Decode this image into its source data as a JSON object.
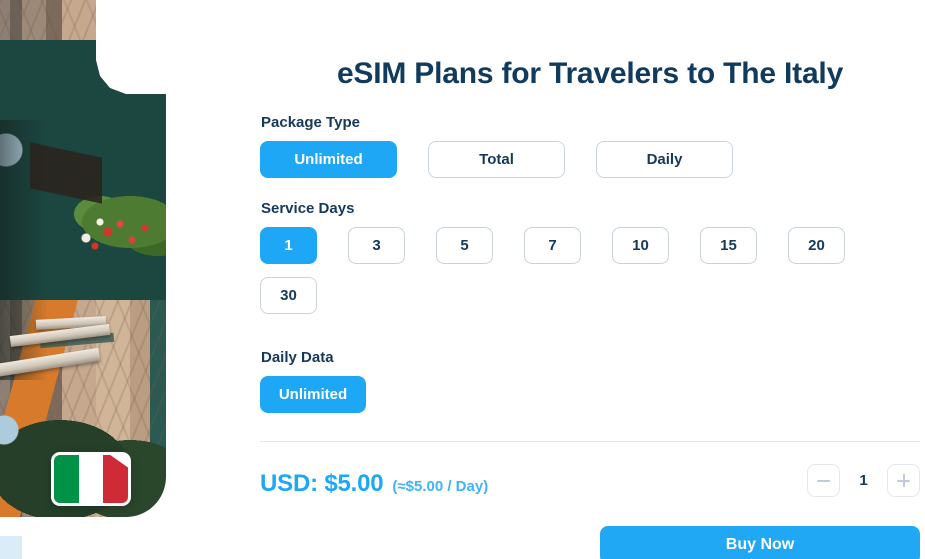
{
  "page": {
    "title": "eSIM Plans for Travelers to The Italy"
  },
  "hero": {
    "image_alt": "italy-alley-photo",
    "flag": {
      "name": "italy-flag",
      "colors": [
        "#009246",
        "#ffffff",
        "#ce2b37"
      ]
    }
  },
  "package_type": {
    "label": "Package Type",
    "options": [
      {
        "label": "Unlimited",
        "selected": true
      },
      {
        "label": "Total",
        "selected": false
      },
      {
        "label": "Daily",
        "selected": false
      }
    ]
  },
  "service_days": {
    "label": "Service Days",
    "options": [
      {
        "label": "1",
        "selected": true
      },
      {
        "label": "3",
        "selected": false
      },
      {
        "label": "5",
        "selected": false
      },
      {
        "label": "7",
        "selected": false
      },
      {
        "label": "10",
        "selected": false
      },
      {
        "label": "15",
        "selected": false
      },
      {
        "label": "20",
        "selected": false
      },
      {
        "label": "30",
        "selected": false
      }
    ]
  },
  "daily_data": {
    "label": "Daily Data",
    "options": [
      {
        "label": "Unlimited",
        "selected": true
      }
    ]
  },
  "price": {
    "main": "USD: $5.00",
    "per_day": "(≈$5.00 / Day)"
  },
  "quantity": {
    "value": "1",
    "decrease_icon": "minus-icon",
    "increase_icon": "plus-icon"
  },
  "actions": {
    "buy_label": "Buy Now"
  },
  "colors": {
    "accent": "#21a8f5",
    "title": "#113a5d",
    "border": "#c7d3de",
    "divider": "#e4e7ea"
  }
}
